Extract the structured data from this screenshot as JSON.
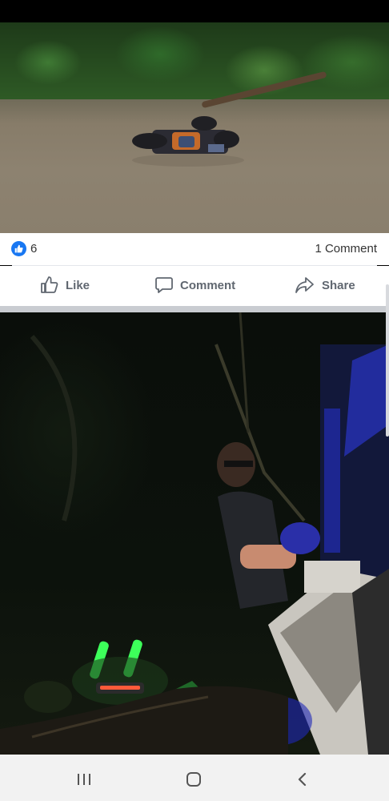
{
  "post": {
    "like_count": "6",
    "comment_count": "1 Comment"
  },
  "actions": {
    "like_label": "Like",
    "comment_label": "Comment",
    "share_label": "Share"
  },
  "icons": {
    "like_badge": "thumbs-up-icon",
    "like": "thumbs-up-outline-icon",
    "comment": "speech-bubble-icon",
    "share": "share-arrow-icon",
    "recent_apps": "recent-apps-icon",
    "home": "home-icon",
    "back": "back-chevron-icon"
  },
  "colors": {
    "brand_blue": "#1877f2",
    "action_gray": "#606770",
    "separator": "#c9ccd1",
    "nav_background": "#f2f2f2"
  }
}
